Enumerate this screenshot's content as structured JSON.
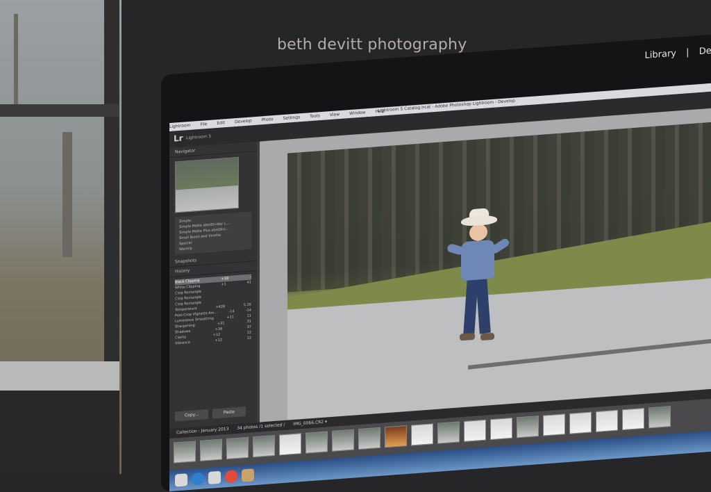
{
  "watermark": "beth devitt photography",
  "window_title": "Lightroom 5 Catalog.lrcat - Adobe Photoshop Lightroom - Develop",
  "menu": [
    "Lightroom",
    "File",
    "Edit",
    "Develop",
    "Photo",
    "Settings",
    "Tools",
    "View",
    "Window",
    "Help"
  ],
  "app": {
    "logo": "Lr",
    "name": "Lightroom 5"
  },
  "modules": [
    "Library",
    "|",
    "Devel"
  ],
  "left_panel": {
    "navigator": "Navigator",
    "presets": [
      "Simple",
      "Simple Matte abstDivider L...",
      "Simple Matte Plus abstDivi...",
      "Small Boost and Vinette",
      "Special",
      "Warmly"
    ],
    "snapshots": "Snapshots",
    "history": "History",
    "history_items": [
      {
        "label": "Black Clipping",
        "a": "+18",
        "b": "-"
      },
      {
        "label": "White Clipping",
        "a": "+1",
        "b": "41"
      },
      {
        "label": "Crop Rectangle",
        "a": "",
        "b": ""
      },
      {
        "label": "Crop Rectangle",
        "a": "",
        "b": ""
      },
      {
        "label": "Crop Rectangle",
        "a": "",
        "b": ""
      },
      {
        "label": "Temperature",
        "a": "+428",
        "b": "5.1K"
      },
      {
        "label": "Post-Crop Vignette Am...",
        "a": "-14",
        "b": "-14"
      },
      {
        "label": "Luminance Smoothing",
        "a": "+11",
        "b": "11"
      },
      {
        "label": "Sharpening",
        "a": "+31",
        "b": "31"
      },
      {
        "label": "Shadows",
        "a": "+36",
        "b": "37"
      },
      {
        "label": "Clarity",
        "a": "+12",
        "b": "12"
      },
      {
        "label": "Vibrance",
        "a": "+12",
        "b": "12"
      }
    ],
    "copy_label": "Copy...",
    "paste_label": "Paste"
  },
  "filmstrip": {
    "collection": "Collection : January 2013",
    "count": "34 photos /1 selected /",
    "filename": "IMG_0066.CR2 ▾"
  }
}
